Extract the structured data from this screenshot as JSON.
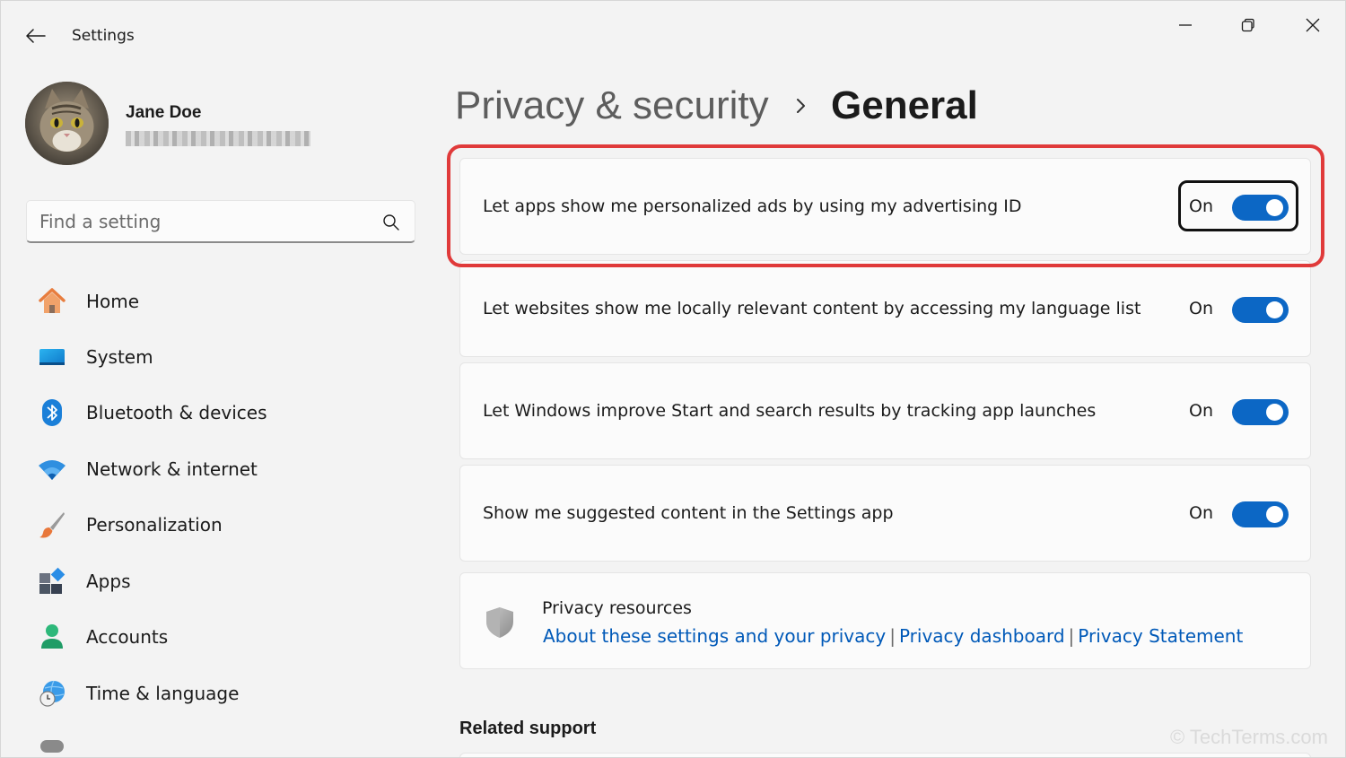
{
  "window": {
    "app_title": "Settings",
    "controls": [
      "minimize-icon",
      "restore-icon",
      "close-icon"
    ]
  },
  "profile": {
    "name": "Jane Doe"
  },
  "search": {
    "placeholder": "Find a setting",
    "value": ""
  },
  "sidebar": {
    "items": [
      {
        "label": "Home",
        "icon": "home-icon"
      },
      {
        "label": "System",
        "icon": "system-icon"
      },
      {
        "label": "Bluetooth & devices",
        "icon": "bluetooth-icon"
      },
      {
        "label": "Network & internet",
        "icon": "wifi-icon"
      },
      {
        "label": "Personalization",
        "icon": "brush-icon"
      },
      {
        "label": "Apps",
        "icon": "apps-icon"
      },
      {
        "label": "Accounts",
        "icon": "accounts-icon"
      },
      {
        "label": "Time & language",
        "icon": "globe-clock-icon"
      }
    ]
  },
  "breadcrumb": {
    "parent": "Privacy & security",
    "current": "General"
  },
  "settings": [
    {
      "label": "Let apps show me personalized ads by using my advertising ID",
      "state": "On",
      "on": true,
      "highlighted": true
    },
    {
      "label": "Let websites show me locally relevant content by accessing my language list",
      "state": "On",
      "on": true
    },
    {
      "label": "Let Windows improve Start and search results by tracking app launches",
      "state": "On",
      "on": true
    },
    {
      "label": "Show me suggested content in the Settings app",
      "state": "On",
      "on": true
    }
  ],
  "privacy_resources": {
    "title": "Privacy resources",
    "links": [
      "About these settings and your privacy",
      "Privacy dashboard",
      "Privacy Statement"
    ],
    "separator": "|"
  },
  "related_support": {
    "heading": "Related support"
  },
  "watermark": "© TechTerms.com",
  "colors": {
    "accent": "#0c67c5",
    "link": "#0059b8",
    "highlight": "#e03a3a",
    "background": "#f3f3f3",
    "card": "#fbfbfb"
  }
}
